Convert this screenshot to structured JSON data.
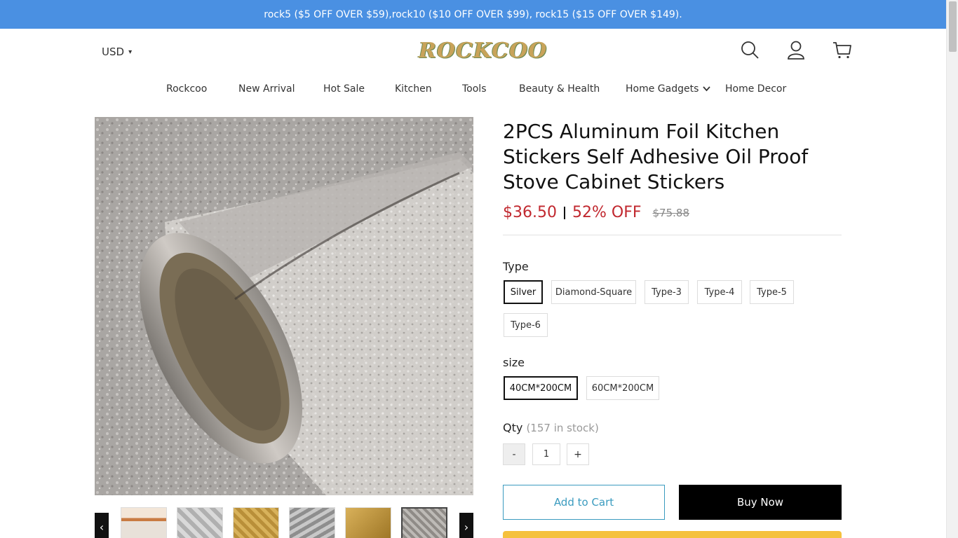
{
  "promo": {
    "text": "rock5 ($5 OFF OVER $59),rock10 ($10 OFF OVER $99), rock15 ($15 OFF OVER $149)."
  },
  "header": {
    "currency": "USD",
    "logo": "ROCKCOO",
    "icons": [
      "search-icon",
      "user-icon",
      "cart-icon"
    ]
  },
  "nav": {
    "items": [
      "Rockcoo",
      "New Arrival",
      "Hot Sale",
      "Kitchen",
      "Tools",
      "Beauty & Health",
      "Home Gadgets",
      "Home Decor"
    ]
  },
  "product": {
    "title": "2PCS Aluminum Foil Kitchen Stickers Self Adhesive Oil Proof Stove Cabinet Stickers",
    "price": "$36.50",
    "discount": "52% OFF",
    "original_price": "$75.88",
    "type_label": "Type",
    "types": [
      "Silver",
      "Diamond-Square",
      "Type-3",
      "Type-4",
      "Type-5",
      "Type-6"
    ],
    "selected_type": "Silver",
    "size_label": "size",
    "sizes": [
      "40CM*200CM",
      "60CM*200CM"
    ],
    "selected_size": "40CM*200CM",
    "qty_label": "Qty",
    "stock_text": "(157 in stock)",
    "qty_value": "1",
    "minus_label": "-",
    "plus_label": "+",
    "add_to_cart_label": "Add to Cart",
    "buy_now_label": "Buy Now"
  },
  "gallery": {
    "prev_label": "‹",
    "next_label": "›",
    "thumb_count": 6,
    "active_thumb": 6
  },
  "colors": {
    "promo_bg": "#4a90e2",
    "price": "#c1282f",
    "add_to_cart": "#3a9bbf",
    "paypal": "#f5c13d"
  }
}
